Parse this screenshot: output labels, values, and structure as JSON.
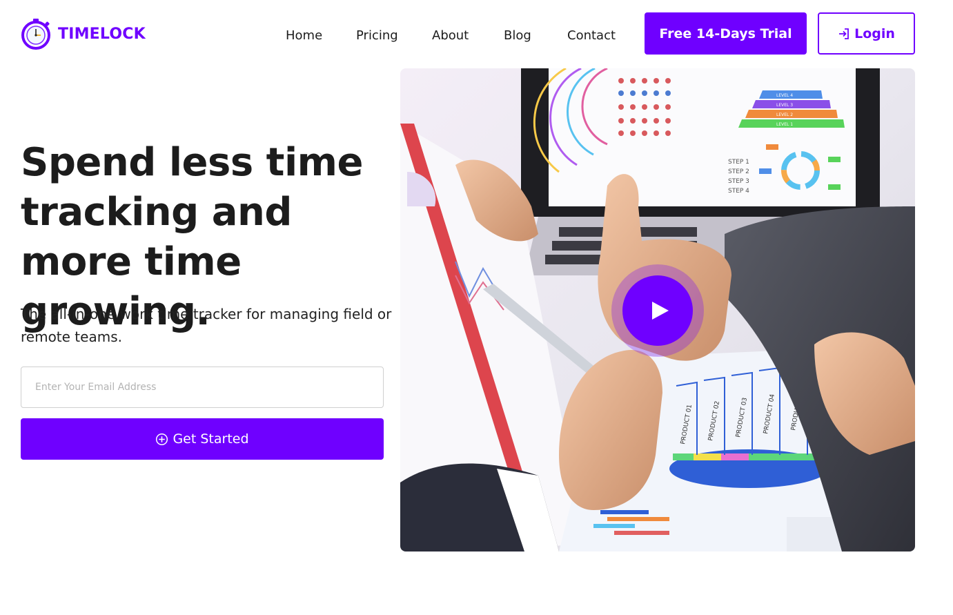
{
  "brand": {
    "name": "TIMELOCK",
    "color": "#6f00ff",
    "logo_icon": "stopwatch-icon"
  },
  "nav": {
    "items": [
      "Home",
      "Pricing",
      "About",
      "Blog",
      "Contact"
    ]
  },
  "header": {
    "trial_label": "Free 14-Days Trial",
    "login_label": "Login",
    "login_icon": "sign-in-icon"
  },
  "hero": {
    "headline": "Spend less time tracking and more time growing.",
    "subtitle": "The all-in-one work time tracker for managing field or remote teams.",
    "email_placeholder": "Enter Your Email Address",
    "cta_label": "Get Started",
    "cta_icon": "plus-circle-icon",
    "media_icon": "play-icon",
    "image_text": {
      "levels": [
        "LEVEL 4",
        "LEVEL 3",
        "LEVEL 2",
        "LEVEL 1"
      ],
      "steps": [
        "STEP 1",
        "STEP 2",
        "STEP 3",
        "STEP 4"
      ],
      "products": [
        "PRODUCT 01",
        "PRODUCT 02",
        "PRODUCT 03",
        "PRODUCT 04",
        "PRODUCT 05"
      ]
    }
  }
}
